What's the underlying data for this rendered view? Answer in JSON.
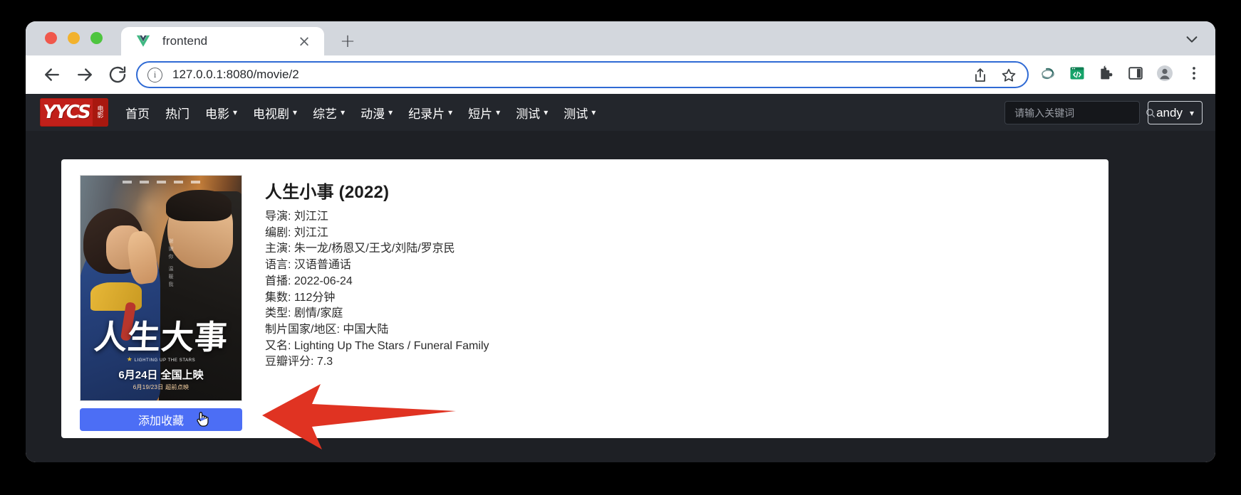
{
  "browser": {
    "window_controls": [
      "close",
      "minimize",
      "maximize"
    ],
    "tab": {
      "title": "frontend",
      "favicon": "vue-logo-icon",
      "close_label": "×"
    },
    "new_tab_label": "+",
    "tab_list_chevron": "⌄",
    "nav": {
      "back": "←",
      "forward": "→",
      "reload": "⟳"
    },
    "omnibox": {
      "info_icon": "info-icon",
      "url": "127.0.0.1:8080/movie/2"
    },
    "toolbar_icons": [
      "share-icon",
      "bookmark-star-icon",
      "swirl-extension-icon",
      "code-window-extension-icon",
      "puzzle-extension-icon",
      "side-panel-icon",
      "profile-avatar-icon",
      "three-dot-menu-icon"
    ]
  },
  "site": {
    "logo": {
      "text": "YYCS",
      "badge": "电影"
    },
    "menu": [
      {
        "label": "首页",
        "has_dropdown": false
      },
      {
        "label": "热门",
        "has_dropdown": false
      },
      {
        "label": "电影",
        "has_dropdown": true
      },
      {
        "label": "电视剧",
        "has_dropdown": true
      },
      {
        "label": "综艺",
        "has_dropdown": true
      },
      {
        "label": "动漫",
        "has_dropdown": true
      },
      {
        "label": "纪录片",
        "has_dropdown": true
      },
      {
        "label": "短片",
        "has_dropdown": true
      },
      {
        "label": "测试",
        "has_dropdown": true
      },
      {
        "label": "测试",
        "has_dropdown": true
      }
    ],
    "search": {
      "placeholder": "请输入关键词",
      "value": "",
      "icon": "search-icon"
    },
    "user": {
      "name": "andy",
      "chevron": "⌄"
    }
  },
  "movie": {
    "title": "人生小事 (2022)",
    "details": [
      "导演: 刘江江",
      "编剧: 刘江江",
      "主演: 朱一龙/杨恩又/王戈/刘陆/罗京民",
      "语言: 汉语普通话",
      "首播: 2022-06-24",
      "集数: 112分钟",
      "类型: 剧情/家庭",
      "制片国家/地区: 中国大陆",
      "又名: Lighting Up The Stars / Funeral Family",
      "豆瓣评分: 7.3"
    ],
    "poster": {
      "title_cn": "人生大事",
      "title_en": "LIGHTING UP THE STARS",
      "release": "6月24日 全国上映",
      "presale": "6月19/23日 超前点映"
    },
    "favorite_button": "添加收藏"
  },
  "annotation": {
    "arrow_color": "#e03322",
    "arrow_direction": "left",
    "cursor": "pointing-hand-cursor"
  },
  "colors": {
    "navbar_bg": "#23262c",
    "page_bg": "#1e2025",
    "logo_red": "#c1201a",
    "button_blue": "#4c6ef5",
    "omnibox_focus": "#2f6ad4"
  }
}
